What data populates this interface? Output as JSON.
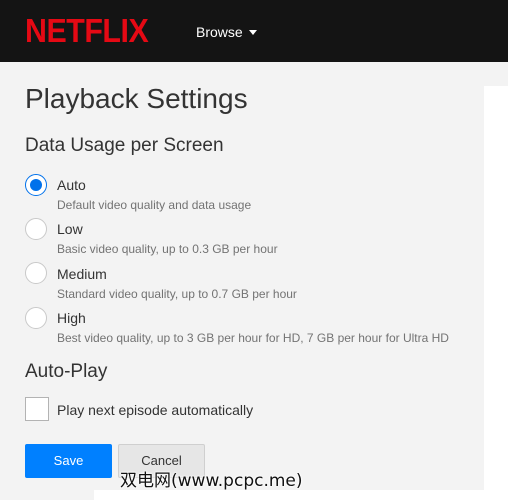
{
  "header": {
    "logo_text": "NETFLIX",
    "browse_label": "Browse"
  },
  "page": {
    "title": "Playback Settings"
  },
  "data_usage": {
    "heading": "Data Usage per Screen",
    "selected": "Auto",
    "options": [
      {
        "label": "Auto",
        "description": "Default video quality and data usage"
      },
      {
        "label": "Low",
        "description": "Basic video quality, up to 0.3 GB per hour"
      },
      {
        "label": "Medium",
        "description": "Standard video quality, up to 0.7 GB per hour"
      },
      {
        "label": "High",
        "description": "Best video quality, up to 3 GB per hour for HD, 7 GB per hour for Ultra HD"
      }
    ]
  },
  "autoplay": {
    "heading": "Auto-Play",
    "checkbox_label": "Play next episode automatically",
    "checked": false
  },
  "buttons": {
    "save_label": "Save",
    "cancel_label": "Cancel"
  },
  "watermark": "双电网(www.pcpc.me)",
  "colors": {
    "brand": "#e50914",
    "accent": "#0080ff",
    "header_bg": "#141414"
  }
}
